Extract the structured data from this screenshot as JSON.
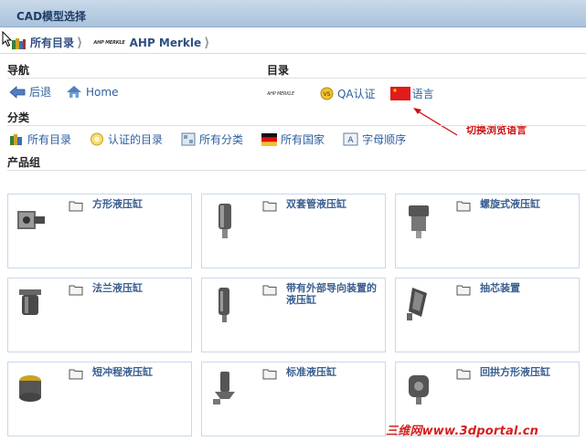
{
  "window": {
    "title": "CAD模型选择"
  },
  "breadcrumb": {
    "items": [
      {
        "label": "所有目录"
      },
      {
        "label": "AHP Merkle",
        "logo_text": "AHP MERKLE"
      }
    ]
  },
  "sections": {
    "nav": "导航",
    "catalog": "目录",
    "category": "分类",
    "product_group": "产品组"
  },
  "nav": {
    "back": "后退",
    "home": "Home"
  },
  "catalog_links": {
    "logo_text": "AHP MERKLE",
    "qa": "QA认证",
    "language": "语言"
  },
  "annotation": {
    "text": "切换浏览语言"
  },
  "category_links": [
    {
      "label": "所有目录"
    },
    {
      "label": "认证的目录"
    },
    {
      "label": "所有分类"
    },
    {
      "label": "所有国家"
    },
    {
      "label": "字母顺序"
    }
  ],
  "products": [
    {
      "name": "方形液压缸"
    },
    {
      "name": "双套管液压缸"
    },
    {
      "name": "螺旋式液压缸"
    },
    {
      "name": "法兰液压缸"
    },
    {
      "name": "带有外部导向装置的液压缸"
    },
    {
      "name": "抽芯装置"
    },
    {
      "name": "短冲程液压缸"
    },
    {
      "name": "标准液压缸"
    },
    {
      "name": "回拱方形液压缸"
    }
  ],
  "watermark": {
    "text": "三维网www.3dportal.cn"
  },
  "colors": {
    "accent": "#2f5f9f",
    "titlebar": "#b6cbe0",
    "annotation": "#cc1111"
  }
}
